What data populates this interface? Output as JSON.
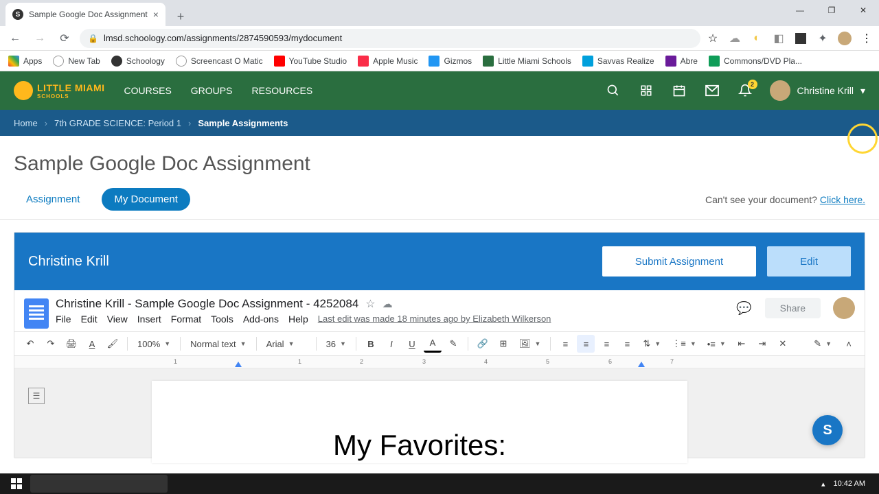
{
  "browser": {
    "tab_title": "Sample Google Doc Assignment",
    "url": "lmsd.schoology.com/assignments/2874590593/mydocument"
  },
  "bookmarks": [
    "Apps",
    "New Tab",
    "Schoology",
    "Screencast O Matic",
    "YouTube Studio",
    "Apple Music",
    "Gizmos",
    "Little Miami Schools",
    "Savvas Realize",
    "Abre",
    "Commons/DVD Pla..."
  ],
  "schoology": {
    "logo_text": "LITTLE MIAMI",
    "logo_sub": "SCHOOLS",
    "nav": [
      "COURSES",
      "GROUPS",
      "RESOURCES"
    ],
    "notification_count": "2",
    "user_name": "Christine Krill"
  },
  "breadcrumb": {
    "home": "Home",
    "course": "7th GRADE SCIENCE: Period 1",
    "current": "Sample Assignments"
  },
  "page": {
    "title": "Sample Google Doc Assignment",
    "tabs": {
      "assignment": "Assignment",
      "my_document": "My Document"
    },
    "help_text": "Can't see your document? ",
    "help_link": "Click here."
  },
  "doc_panel": {
    "author": "Christine Krill",
    "submit_label": "Submit Assignment",
    "edit_label": "Edit"
  },
  "gdoc": {
    "title": "Christine Krill - Sample Google Doc Assignment - 4252084",
    "menus": [
      "File",
      "Edit",
      "View",
      "Insert",
      "Format",
      "Tools",
      "Add-ons",
      "Help"
    ],
    "last_edit": "Last edit was made 18 minutes ago by Elizabeth Wilkerson",
    "share_label": "Share",
    "toolbar": {
      "zoom": "100%",
      "style": "Normal text",
      "font": "Arial",
      "size": "36"
    },
    "doc_text": "My Favorites:"
  },
  "ruler_marks": [
    "1",
    "1",
    "2",
    "3",
    "4",
    "5",
    "6",
    "7"
  ],
  "system": {
    "time": "10:42 AM"
  }
}
